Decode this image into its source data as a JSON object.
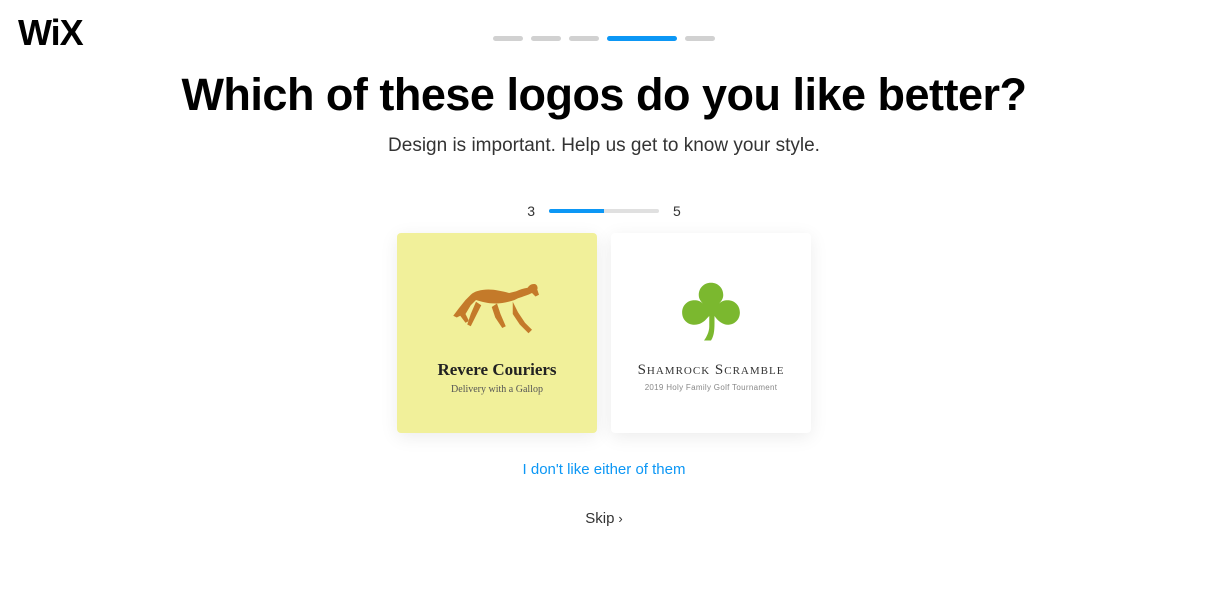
{
  "brand": "WiX",
  "heading": "Which of these logos do you like better?",
  "subheading": "Design is important. Help us get to know your style.",
  "subprogress": {
    "current": "3",
    "total": "5"
  },
  "cards": {
    "left": {
      "title": "Revere Couriers",
      "subtitle": "Delivery with a Gallop"
    },
    "right": {
      "title": "Shamrock Scramble",
      "subtitle": "2019 Holy Family Golf Tournament"
    }
  },
  "neither_label": "I don't like either of them",
  "skip_label": "Skip"
}
